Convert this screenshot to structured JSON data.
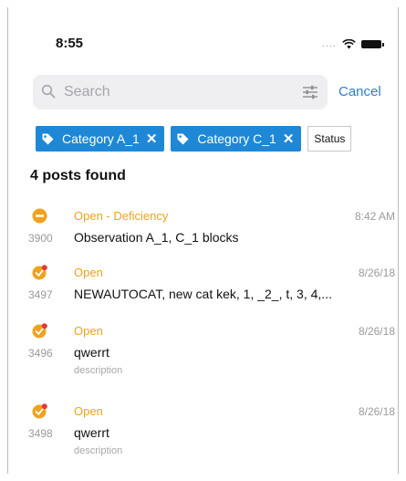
{
  "status_bar": {
    "time": "8:55",
    "signal": "...."
  },
  "search": {
    "placeholder": "Search",
    "value": "",
    "cancel_label": "Cancel"
  },
  "chips": [
    {
      "label": "Category A_1",
      "close": "✕"
    },
    {
      "label": "Category C_1",
      "close": "✕"
    }
  ],
  "status_chip": {
    "label": "Status"
  },
  "results_count": "4 posts found",
  "posts": [
    {
      "status": "Open - Deficiency",
      "date": "8:42 AM",
      "id": "3900",
      "title": "Observation A_1, C_1 blocks",
      "description": "",
      "icon": "deficiency-icon"
    },
    {
      "status": "Open",
      "date": "8/26/18",
      "id": "3497",
      "title": "NEWAUTOCAT, new cat kek, 1, _2_, t, 3, 4,...",
      "description": "",
      "icon": "open-icon"
    },
    {
      "status": "Open",
      "date": "8/26/18",
      "id": "3496",
      "title": "qwerrt",
      "description": "description",
      "icon": "open-icon"
    },
    {
      "status": "Open",
      "date": "8/26/18",
      "id": "3498",
      "title": "qwerrt",
      "description": "description",
      "icon": "open-icon"
    }
  ],
  "colors": {
    "accent": "#1e88d6",
    "open": "#f0a21e",
    "badge": "#e53935",
    "link": "#2e7dd7"
  }
}
